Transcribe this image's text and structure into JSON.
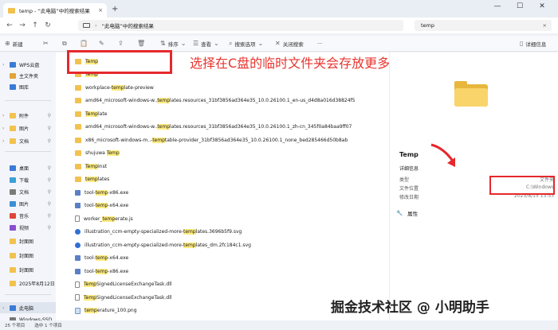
{
  "window": {
    "tab_title": "temp - “此电脑”中的搜索结果",
    "tab_close": "×",
    "new_tab": "+",
    "minimize": "—",
    "maximize": "☐",
    "close": "✕"
  },
  "address": {
    "path": "“此电脑”中的搜索结果",
    "search_value": "temp",
    "search_clear": "×"
  },
  "toolbar": {
    "new": "新建",
    "sort": "排序",
    "view": "查看",
    "search_options": "搜索选项",
    "close_search": "关闭搜索",
    "more": "···",
    "details": "详细信息"
  },
  "sidebar": {
    "items": [
      {
        "label": "WPS云盘",
        "color": "#3a7bd5"
      },
      {
        "label": "主文件夹",
        "color": "#e3a43a"
      },
      {
        "label": "图库",
        "color": "#3a7bd5"
      },
      {
        "label": "附件",
        "color": "#f2c24f"
      },
      {
        "label": "图片",
        "color": "#f2c24f"
      },
      {
        "label": "文档",
        "color": "#f2c24f"
      },
      {
        "label": "桌面",
        "color": "#3a7bd5"
      },
      {
        "label": "下载",
        "color": "#3aa1d5"
      },
      {
        "label": "文档",
        "color": "#7a7a7a"
      },
      {
        "label": "图片",
        "color": "#3a8fd5"
      },
      {
        "label": "音乐",
        "color": "#e0453a"
      },
      {
        "label": "视频",
        "color": "#8a4fd0"
      },
      {
        "label": "封面图",
        "color": "#f2c24f"
      },
      {
        "label": "封面图",
        "color": "#f2c24f"
      },
      {
        "label": "封面图",
        "color": "#f2c24f"
      },
      {
        "label": "2025年8月12日",
        "color": "#f2c24f"
      },
      {
        "label": "此电脑",
        "color": "#3a7bd5"
      },
      {
        "label": "Windows-SSD",
        "color": "#777777"
      }
    ]
  },
  "files": [
    {
      "type": "folder",
      "pre": "",
      "hl": "Temp",
      "post": ""
    },
    {
      "type": "folder",
      "pre": "",
      "hl": "Temp",
      "post": ""
    },
    {
      "type": "folder",
      "pre": "workplace-",
      "hl": "temp",
      "post": "late-preview"
    },
    {
      "type": "folder",
      "pre": "amd64_microsoft-windows-w..",
      "hl": "temp",
      "post": "lates.resources_31bf3856ad364e35_10.0.26100.1_en-us_d4d8a016d38824f5"
    },
    {
      "type": "folder",
      "pre": "",
      "hl": "Temp",
      "post": "late"
    },
    {
      "type": "folder",
      "pre": "amd64_microsoft-windows-w..",
      "hl": "temp",
      "post": "lates.resources_31bf3856ad364e35_10.0.26100.1_zh-cn_345f0a84baa9ff07"
    },
    {
      "type": "folder",
      "pre": "x86_microsoft-windows-m..-",
      "hl": "temp",
      "post": "table-provider_31bf3856ad364e35_10.0.26100.1_none_bed285466d50b8ab"
    },
    {
      "type": "folder",
      "pre": "shujuwa ",
      "hl": "Temp",
      "post": ""
    },
    {
      "type": "folder",
      "pre": "",
      "hl": "Temp",
      "post": "Inst"
    },
    {
      "type": "folder",
      "pre": "",
      "hl": "temp",
      "post": "lates"
    },
    {
      "type": "exe",
      "pre": "tool-",
      "hl": "temp",
      "post": "-x86.exe"
    },
    {
      "type": "exe",
      "pre": "tool-",
      "hl": "temp",
      "post": "-x64.exe"
    },
    {
      "type": "js",
      "pre": "worker_",
      "hl": "temp",
      "post": "erate.js"
    },
    {
      "type": "svg",
      "pre": "illustration_ccm-empty-specialized-more-",
      "hl": "temp",
      "post": "lates.3696b5f9.svg"
    },
    {
      "type": "svg",
      "pre": "illustration_ccm-empty-specialized-more-",
      "hl": "temp",
      "post": "lates_dm.2fc184c1.svg"
    },
    {
      "type": "exe",
      "pre": "tool-",
      "hl": "temp",
      "post": "-x64.exe"
    },
    {
      "type": "exe",
      "pre": "tool-",
      "hl": "temp",
      "post": "-x86.exe"
    },
    {
      "type": "file",
      "pre": "",
      "hl": "Temp",
      "post": "SignedLicenseExchangeTask.dll"
    },
    {
      "type": "file",
      "pre": "",
      "hl": "Temp",
      "post": "SignedLicenseExchangeTask.dll"
    },
    {
      "type": "png",
      "pre": "",
      "hl": "temp",
      "post": "erature_100.png"
    }
  ],
  "annotation": "选择在C盘的临时文件夹会存放更多文件",
  "details": {
    "name": "Temp",
    "section": "详细信息",
    "rows": [
      {
        "label": "类型",
        "value": "文件夹"
      },
      {
        "label": "文件位置",
        "value": "C:\\Windows"
      },
      {
        "label": "修改日期",
        "value": "2025/8/15 13:53"
      }
    ],
    "properties": "属性"
  },
  "status": {
    "count": "25 个项目",
    "selected": "选中 1 个项目"
  },
  "watermark": "掘金技术社区 @ 小明助手"
}
